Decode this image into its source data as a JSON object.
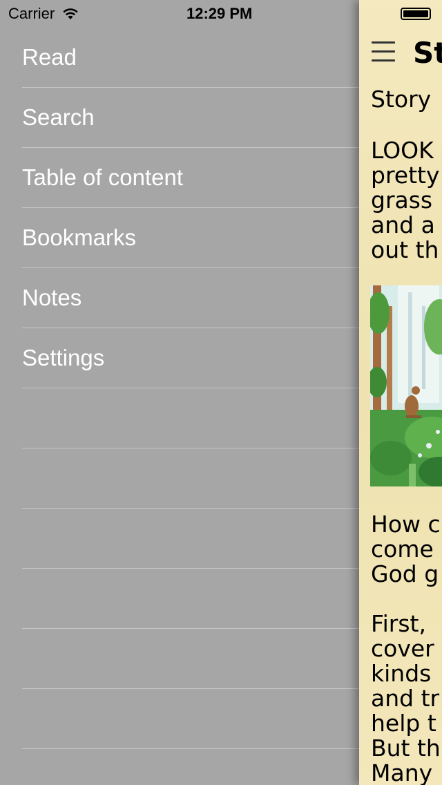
{
  "status_bar": {
    "carrier": "Carrier",
    "time": "12:29 PM"
  },
  "menu": {
    "items": [
      {
        "label": "Read"
      },
      {
        "label": "Search"
      },
      {
        "label": "Table of content"
      },
      {
        "label": "Bookmarks"
      },
      {
        "label": "Notes"
      },
      {
        "label": "Settings"
      },
      {
        "label": ""
      },
      {
        "label": ""
      },
      {
        "label": ""
      },
      {
        "label": ""
      },
      {
        "label": ""
      },
      {
        "label": ""
      }
    ]
  },
  "content": {
    "title": "St",
    "story_line": "Story",
    "paragraph1": [
      "LOOK",
      "pretty",
      "grass",
      "and a",
      "out th"
    ],
    "paragraph2": [
      "How c",
      "come",
      "God g"
    ],
    "paragraph3": [
      "First,",
      "cover",
      "kinds",
      "and tr",
      "help t",
      "But th",
      "Many"
    ]
  },
  "colors": {
    "menu_background": "#a6a6a6",
    "menu_text": "#ffffff",
    "page_background": "#f2e6b8"
  }
}
